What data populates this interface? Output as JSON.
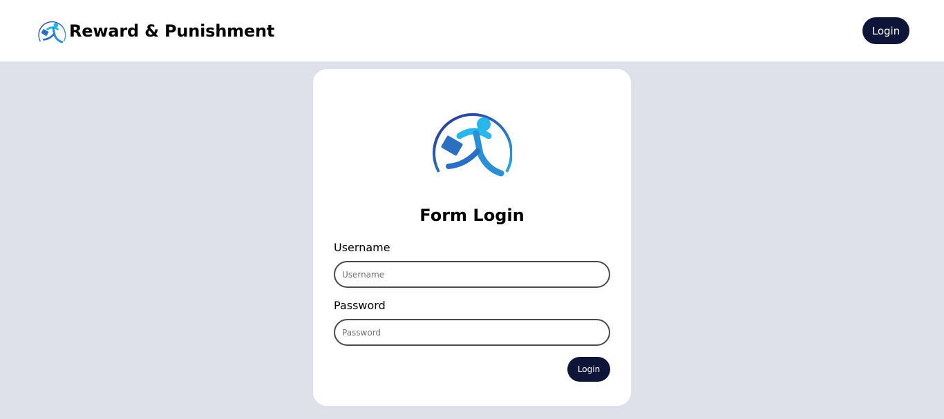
{
  "header": {
    "brand_title": "Reward & Punishment",
    "login_label": "Login",
    "logo_icon": "runner-briefcase-icon"
  },
  "login_form": {
    "logo_icon": "runner-briefcase-icon",
    "title": "Form Login",
    "username_label": "Username",
    "username_placeholder": "Username",
    "username_value": "",
    "password_label": "Password",
    "password_placeholder": "Password",
    "password_value": "",
    "submit_label": "Login"
  },
  "colors": {
    "page_background": "#dee0ea",
    "button_background": "#0f1538",
    "logo_light_blue": "#29b6ea",
    "logo_dark_blue": "#2b3a8f"
  }
}
